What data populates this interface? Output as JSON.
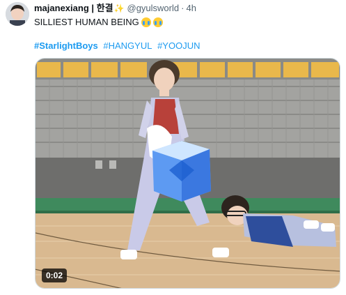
{
  "tweet": {
    "display_name": "majanexiang | 한결",
    "sparkle_icon": "sparkles-icon",
    "handle": "@gyulsworld",
    "separator": "·",
    "time": "4h",
    "text": "SILLIEST HUMAN BEING",
    "emoji": [
      "loudly-crying-face-emoji",
      "loudly-crying-face-emoji"
    ],
    "hashtags": [
      "#StarlightBoys",
      "#HANGYUL",
      "#YOOJUN"
    ]
  },
  "video": {
    "timestamp": "0:02"
  },
  "colors": {
    "link": "#1d9bf0",
    "text": "#0f1419",
    "muted": "#536471"
  }
}
